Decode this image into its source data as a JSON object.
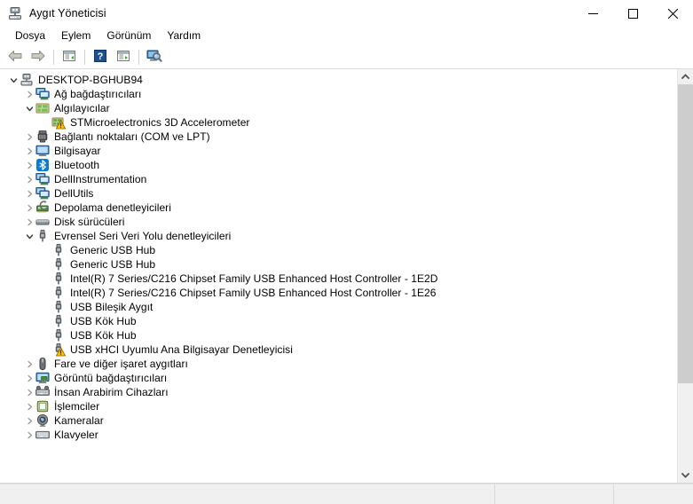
{
  "window": {
    "title": "Aygıt Yöneticisi",
    "title_icon": "device-manager-icon",
    "minimize_label": "—",
    "maximize_label": "□",
    "close_label": "✕"
  },
  "menubar": {
    "items": [
      {
        "label": "Dosya",
        "name": "menu-dosya"
      },
      {
        "label": "Eylem",
        "name": "menu-eylem"
      },
      {
        "label": "Görünüm",
        "name": "menu-gorunum"
      },
      {
        "label": "Yardım",
        "name": "menu-yardim"
      }
    ]
  },
  "toolbar": {
    "buttons": [
      {
        "icon": "back-arrow-icon",
        "tip": "Geri"
      },
      {
        "icon": "forward-arrow-icon",
        "tip": "İleri"
      },
      {
        "icon": "properties-icon",
        "tip": "Özellikler"
      },
      {
        "icon": "help-icon",
        "tip": "Yardım"
      },
      {
        "icon": "update-driver-icon",
        "tip": "Sürücüyü güncelleştir"
      },
      {
        "icon": "scan-hardware-icon",
        "tip": "Donanım değişikliklerini tara"
      }
    ]
  },
  "tree": {
    "rows": [
      {
        "depth": 0,
        "state": "expanded",
        "icon": "computer-root-icon",
        "label": "DESKTOP-BGHUB94",
        "warning": false
      },
      {
        "depth": 1,
        "state": "collapsed",
        "icon": "network-adapter-icon",
        "label": "Ağ bağdaştırıcıları",
        "warning": false
      },
      {
        "depth": 1,
        "state": "expanded",
        "icon": "sensor-icon",
        "label": "Algılayıcılar",
        "warning": false
      },
      {
        "depth": 2,
        "state": "leaf",
        "icon": "sensor-device-icon",
        "label": "STMicroelectronics 3D Accelerometer",
        "warning": true
      },
      {
        "depth": 1,
        "state": "collapsed",
        "icon": "port-icon",
        "label": "Bağlantı noktaları (COM ve LPT)",
        "warning": false
      },
      {
        "depth": 1,
        "state": "collapsed",
        "icon": "monitor-icon",
        "label": "Bilgisayar",
        "warning": false
      },
      {
        "depth": 1,
        "state": "collapsed",
        "icon": "bluetooth-icon",
        "label": "Bluetooth",
        "warning": false
      },
      {
        "depth": 1,
        "state": "collapsed",
        "icon": "network-adapter-icon",
        "label": "DellInstrumentation",
        "warning": false
      },
      {
        "depth": 1,
        "state": "collapsed",
        "icon": "network-adapter-icon",
        "label": "DellUtils",
        "warning": false
      },
      {
        "depth": 1,
        "state": "collapsed",
        "icon": "storage-controller-icon",
        "label": "Depolama denetleyicileri",
        "warning": false
      },
      {
        "depth": 1,
        "state": "collapsed",
        "icon": "disk-drive-icon",
        "label": "Disk sürücüleri",
        "warning": false
      },
      {
        "depth": 1,
        "state": "expanded",
        "icon": "usb-icon",
        "label": "Evrensel Seri Veri Yolu denetleyicileri",
        "warning": false
      },
      {
        "depth": 2,
        "state": "leaf",
        "icon": "usb-icon",
        "label": "Generic USB Hub",
        "warning": false
      },
      {
        "depth": 2,
        "state": "leaf",
        "icon": "usb-icon",
        "label": "Generic USB Hub",
        "warning": false
      },
      {
        "depth": 2,
        "state": "leaf",
        "icon": "usb-icon",
        "label": "Intel(R) 7 Series/C216 Chipset Family USB Enhanced Host Controller - 1E2D",
        "warning": false
      },
      {
        "depth": 2,
        "state": "leaf",
        "icon": "usb-icon",
        "label": "Intel(R) 7 Series/C216 Chipset Family USB Enhanced Host Controller - 1E26",
        "warning": false
      },
      {
        "depth": 2,
        "state": "leaf",
        "icon": "usb-icon",
        "label": "USB Bileşik Aygıt",
        "warning": false
      },
      {
        "depth": 2,
        "state": "leaf",
        "icon": "usb-icon",
        "label": "USB Kök Hub",
        "warning": false
      },
      {
        "depth": 2,
        "state": "leaf",
        "icon": "usb-icon",
        "label": "USB Kök Hub",
        "warning": false
      },
      {
        "depth": 2,
        "state": "leaf",
        "icon": "usb-icon",
        "label": "USB xHCI Uyumlu Ana Bilgisayar Denetleyicisi",
        "warning": true
      },
      {
        "depth": 1,
        "state": "collapsed",
        "icon": "mouse-icon",
        "label": "Fare ve diğer işaret aygıtları",
        "warning": false
      },
      {
        "depth": 1,
        "state": "collapsed",
        "icon": "display-adapter-icon",
        "label": "Görüntü bağdaştırıcıları",
        "warning": false
      },
      {
        "depth": 1,
        "state": "collapsed",
        "icon": "hid-icon",
        "label": "İnsan Arabirim Cihazları",
        "warning": false
      },
      {
        "depth": 1,
        "state": "collapsed",
        "icon": "processor-icon",
        "label": "İşlemciler",
        "warning": false
      },
      {
        "depth": 1,
        "state": "collapsed",
        "icon": "camera-icon",
        "label": "Kameralar",
        "warning": false
      },
      {
        "depth": 1,
        "state": "collapsed",
        "icon": "keyboard-icon",
        "label": "Klavyeler",
        "warning": false
      }
    ]
  },
  "scrollbar": {
    "up_arrow": "chevron-up-icon",
    "down_arrow": "chevron-down-icon",
    "thumb_top_pct": 0,
    "thumb_height_pct": 78
  },
  "statusbar": {
    "cells": [
      "",
      "",
      ""
    ]
  },
  "colors": {
    "accent": "#0078d7",
    "warning": "#ffb900",
    "window_bg": "#ffffff",
    "chrome_bg": "#f0f0f0",
    "scrollbar_thumb": "#cdcdcd"
  }
}
